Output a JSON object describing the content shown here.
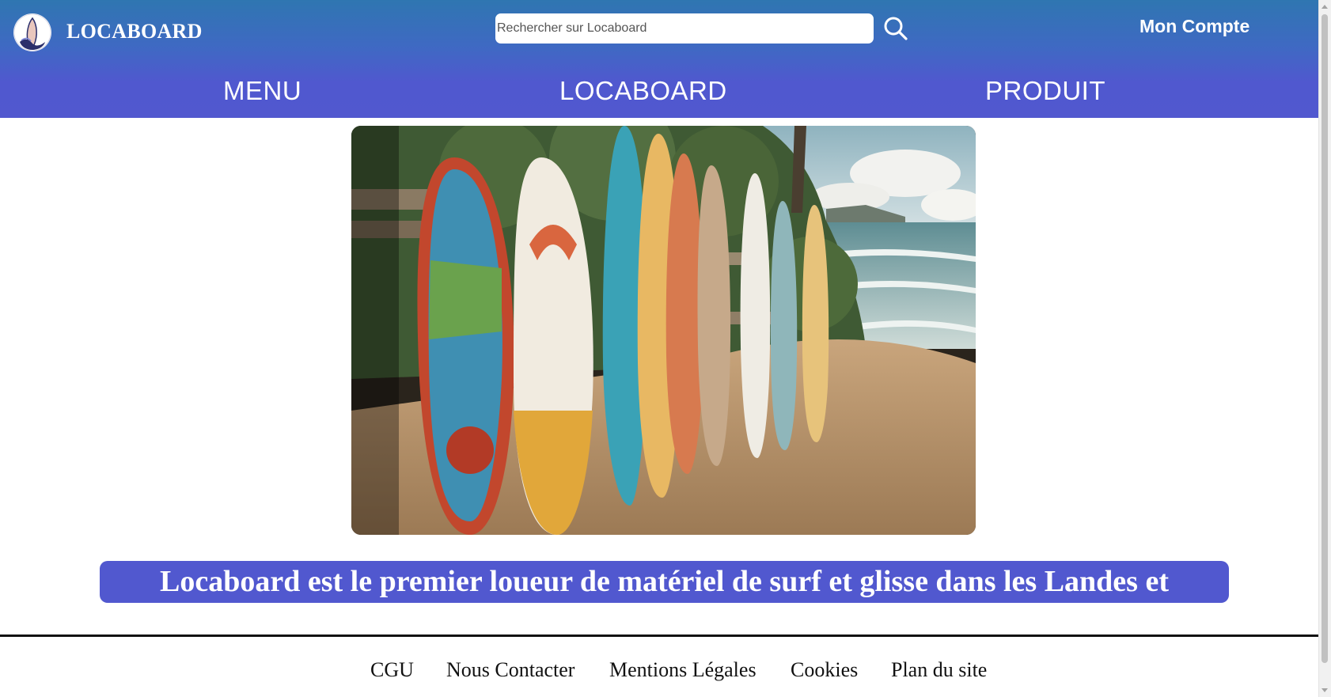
{
  "header": {
    "brand": "LOCABOARD",
    "search": {
      "placeholder": "Rechercher sur Locaboard",
      "value": ""
    },
    "account_label": "Mon Compte"
  },
  "nav": {
    "items": [
      {
        "label": "MENU"
      },
      {
        "label": "LOCABOARD"
      },
      {
        "label": "PRODUIT"
      }
    ]
  },
  "hero": {
    "tagline": "Locaboard est le premier loueur de matériel de surf et glisse dans les Landes et"
  },
  "footer": {
    "links": [
      {
        "label": "CGU"
      },
      {
        "label": "Nous Contacter"
      },
      {
        "label": "Mentions Légales"
      },
      {
        "label": "Cookies"
      },
      {
        "label": "Plan du site"
      }
    ]
  },
  "icons": {
    "logo": "surfboard-wave-logo",
    "search": "search-icon"
  },
  "colors": {
    "header_top": "#2f76b1",
    "header_bottom": "#5158cf",
    "banner": "#5158cf",
    "text_on_brand": "#ffffff",
    "footer_text": "#111111"
  }
}
